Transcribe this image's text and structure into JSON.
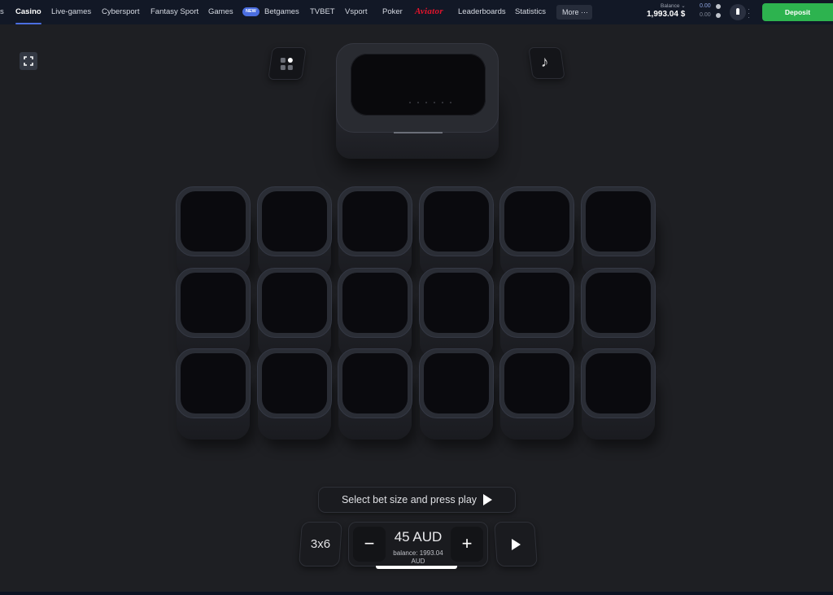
{
  "nav": {
    "items": [
      {
        "label": "s",
        "active": false
      },
      {
        "label": "Casino",
        "active": true
      },
      {
        "label": "Live-games",
        "active": false
      },
      {
        "label": "Cybersport",
        "active": false
      },
      {
        "label": "Fantasy Sport",
        "active": false
      },
      {
        "label": "Games",
        "active": false
      },
      {
        "label": "Betgames",
        "active": false,
        "badge": "NEW"
      },
      {
        "label": "TVBET",
        "active": false
      },
      {
        "label": "Vsport",
        "active": false
      },
      {
        "label": "Poker",
        "active": false
      },
      {
        "label": "Aviator",
        "active": false,
        "brand_color": "#e4142c"
      },
      {
        "label": "Leaderboards",
        "active": false
      },
      {
        "label": "Statistics",
        "active": false
      }
    ],
    "more_label": "More ···"
  },
  "account": {
    "balance_label": "Balance ⌄",
    "balance_value": "1,993.04 $",
    "bonus_1": "0.00",
    "bonus_2": "0.00",
    "deposit_label": "Deposit",
    "deposit_color": "#2db34f"
  },
  "game": {
    "grid_size_label": "3x6",
    "rows": 3,
    "cols": 6,
    "prompt": "Select bet size and press play",
    "bet_amount": "45 AUD",
    "balance_line": "balance: 1993.04",
    "balance_currency": "AUD",
    "minus_label": "−",
    "plus_label": "+",
    "music_icon": "♪"
  },
  "icons": {
    "fullscreen": "fullscreen-icon",
    "menu": "grid-menu-icon",
    "music": "music-note-icon",
    "play": "play-icon"
  }
}
